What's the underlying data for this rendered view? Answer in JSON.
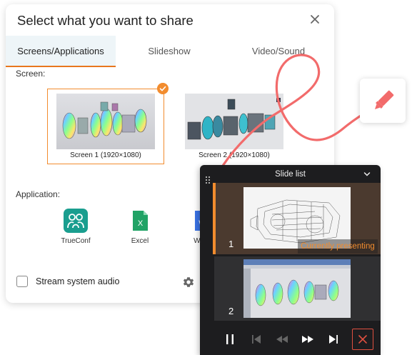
{
  "dialog": {
    "title": "Select what you want to share",
    "close_icon": "close-icon",
    "tabs": [
      {
        "label": "Screens/Applications",
        "active": true
      },
      {
        "label": "Slideshow",
        "active": false
      },
      {
        "label": "Video/Sound",
        "active": false
      }
    ],
    "screen_section_label": "Screen:",
    "screens": [
      {
        "label": "Screen 1 (1920×1080)",
        "selected": true
      },
      {
        "label": "Screen 2 (1920×1080)",
        "selected": false
      }
    ],
    "application_section_label": "Application:",
    "applications": [
      {
        "label": "TrueConf",
        "icon": "trueconf-icon"
      },
      {
        "label": "Excel",
        "icon": "excel-icon"
      },
      {
        "label": "Word",
        "icon": "word-icon"
      }
    ],
    "stream_audio": {
      "label": "Stream system audio",
      "checked": false
    },
    "settings_icon": "gear-icon"
  },
  "annotation": {
    "tool_icon": "marker-icon",
    "stroke_color": "#f26b6b"
  },
  "slide_list": {
    "title": "Slide list",
    "slides": [
      {
        "number": "1",
        "status": "Currently presenting"
      },
      {
        "number": "2",
        "status": ""
      }
    ],
    "controls": [
      "pause-icon",
      "first-slide-icon",
      "rewind-icon",
      "fast-forward-icon",
      "last-slide-icon",
      "stop-icon"
    ]
  },
  "colors": {
    "accent": "#f28c2e",
    "primary": "#1a8fa6",
    "panel_bg": "#1d1d1f",
    "active_slide_bg": "#4b3a2f"
  }
}
